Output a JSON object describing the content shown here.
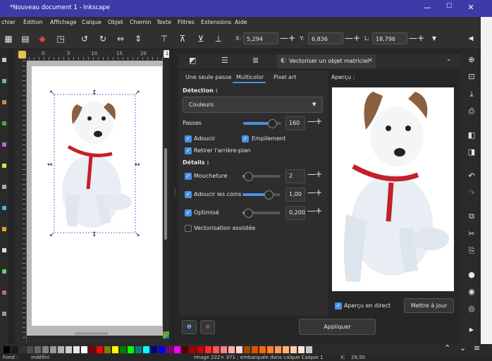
{
  "window": {
    "title": "*Nouveau document 1 - Inkscape",
    "min": "—",
    "max": "☐",
    "close": "✕"
  },
  "menu": [
    "chier",
    "Édition",
    "Affichage",
    "Calque",
    "Objet",
    "Chemin",
    "Texte",
    "Filtres",
    "Extensions",
    "Aide"
  ],
  "toolbar": {
    "x_label": "X:",
    "x_value": "5,294",
    "y_label": "Y:",
    "y_value": "6,836",
    "w_label": "L:",
    "w_value": "18,796"
  },
  "ruler": {
    "h_ticks": [
      "0",
      "5",
      "10",
      "15",
      "20"
    ],
    "page_badge": "1"
  },
  "dialog": {
    "tab_title": "Vectoriser un objet matriciel",
    "subtabs": [
      "Une seule passe",
      "Multicolor",
      "Pixel art"
    ],
    "active_subtab": "Multicolor",
    "detection_heading": "Détection :",
    "mode_value": "Couleurs",
    "passes_label": "Passes",
    "passes_value": "160",
    "passes_level": 0.85,
    "smooth_label": "Adoucir",
    "stack_label": "Empilement",
    "remove_bg_label": "Retirer l'arrière-plan",
    "details_heading": "Détails :",
    "speckles_label": "Moucheture",
    "speckles_value": "2",
    "speckles_level": 0.05,
    "corners_label": "Adoucir les coins",
    "corners_value": "1,00",
    "corners_level": 0.75,
    "optimize_label": "Optimisé",
    "optimize_value": "0,200",
    "optimize_level": 0.05,
    "assisted_label": "Vectorisation assistée",
    "preview_label": "Aperçu :",
    "live_preview_label": "Aperçu en direct",
    "update_button": "Mettre à jour",
    "apply_button": "Appliquer"
  },
  "palette_colors": [
    "#000000",
    "#1a1a1a",
    "#333333",
    "#4d4d4d",
    "#666666",
    "#808080",
    "#999999",
    "#b3b3b3",
    "#cccccc",
    "#e6e6e6",
    "#ffffff",
    "#800000",
    "#ff0000",
    "#808000",
    "#ffff00",
    "#008000",
    "#00ff00",
    "#008080",
    "#00ffff",
    "#000080",
    "#0000ff",
    "#800080",
    "#ff00ff",
    "#550000",
    "#aa0000",
    "#d40000",
    "#ff2a2a",
    "#ff5555",
    "#ff8080",
    "#ffaaaa",
    "#ffd5d5",
    "#aa4400",
    "#d45500",
    "#ff6600",
    "#ff7f2a",
    "#ff9955",
    "#ffb380",
    "#ffccaa",
    "#ffe6d5",
    "#c8c8c8"
  ],
  "status": {
    "fill_label": "Fond :",
    "fill_value": "Indéfini",
    "message": "Image 222× 371 ; embarquée dans calque Calque 1",
    "x_label": "X:",
    "x_value": "29,50"
  }
}
